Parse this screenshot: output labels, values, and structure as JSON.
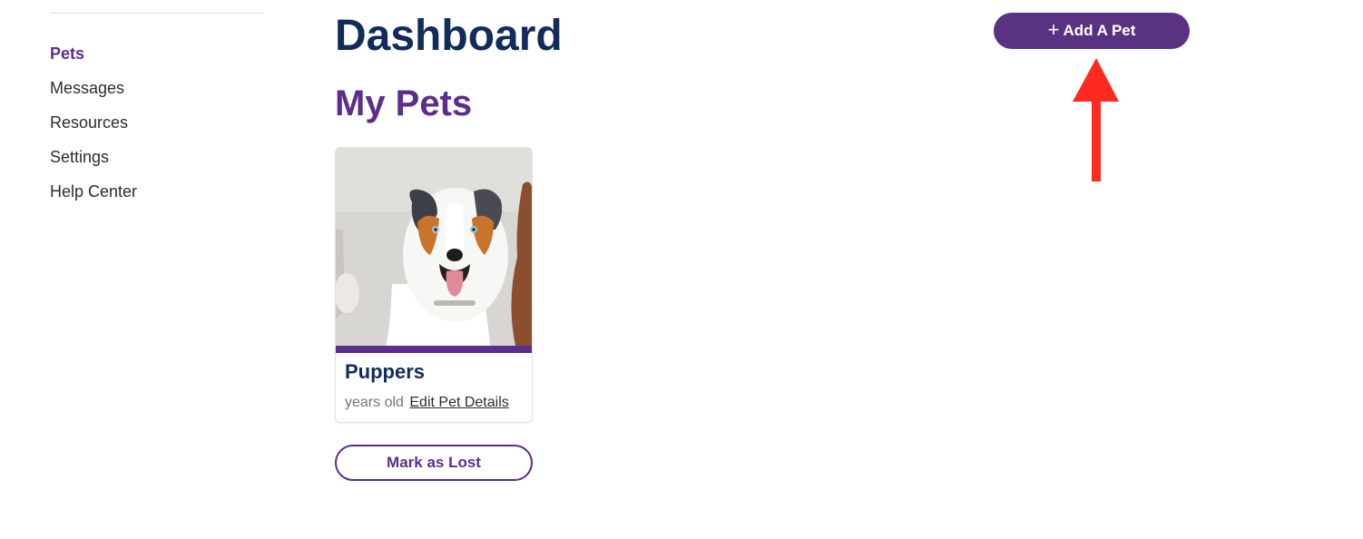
{
  "sidebar": {
    "items": [
      {
        "label": "Pets",
        "active": true
      },
      {
        "label": "Messages",
        "active": false
      },
      {
        "label": "Resources",
        "active": false
      },
      {
        "label": "Settings",
        "active": false
      },
      {
        "label": "Help Center",
        "active": false
      }
    ]
  },
  "header": {
    "title": "Dashboard",
    "add_pet_icon": "+",
    "add_pet_label": "Add A Pet"
  },
  "main": {
    "section_title": "My Pets",
    "pets": [
      {
        "name": "Puppers",
        "age_text": "years old",
        "edit_label": "Edit Pet Details",
        "photo_icon": "dog-photo"
      }
    ],
    "mark_lost_label": "Mark as Lost"
  },
  "annotation": {
    "icon": "red-arrow-up-icon",
    "color": "#ff2a1f"
  },
  "colors": {
    "brand_purple": "#5b2d8e",
    "button_purple": "#5a3282",
    "navy": "#132b5b"
  }
}
